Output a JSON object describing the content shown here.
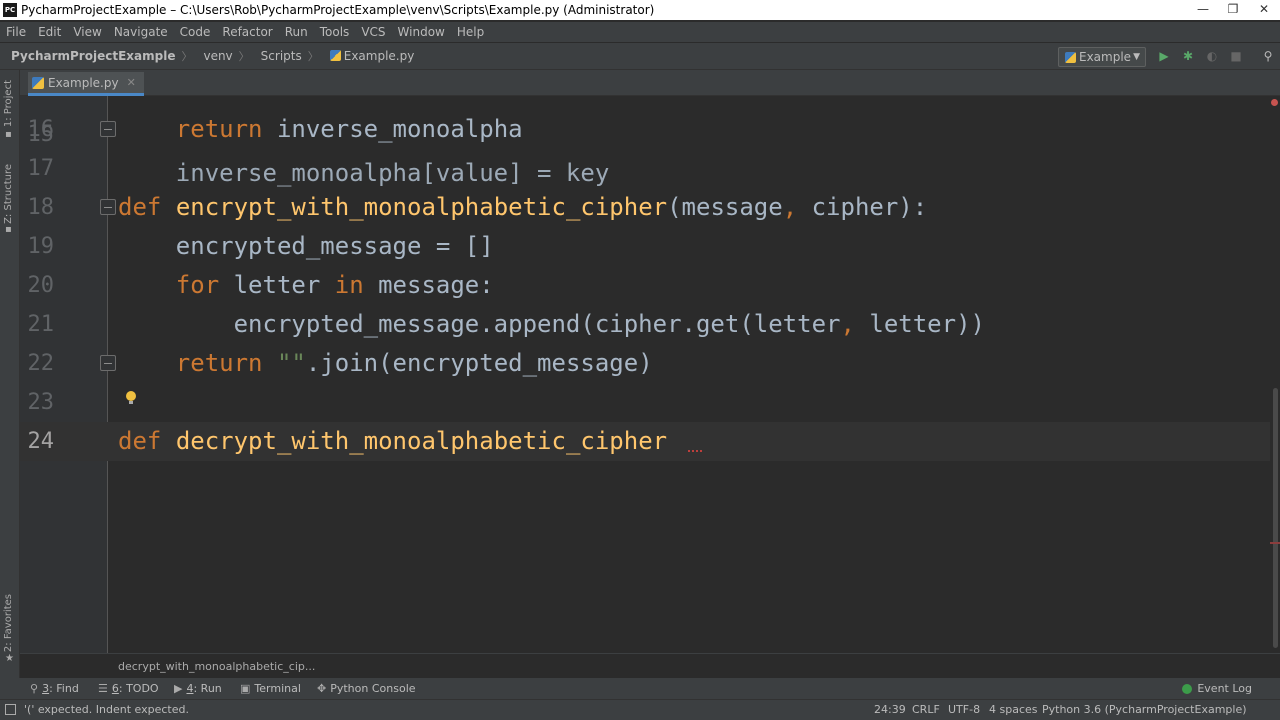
{
  "window": {
    "app_icon": "PC",
    "title": "PycharmProjectExample – C:\\Users\\Rob\\PycharmProjectExample\\venv\\Scripts\\Example.py (Administrator)",
    "controls": {
      "minimize": "—",
      "maximize": "❐",
      "close": "✕"
    }
  },
  "menu": [
    "File",
    "Edit",
    "View",
    "Navigate",
    "Code",
    "Refactor",
    "Run",
    "Tools",
    "VCS",
    "Window",
    "Help"
  ],
  "navbar": {
    "breadcrumbs": [
      "PycharmProjectExample",
      "venv",
      "Scripts",
      "Example.py"
    ],
    "run_config": "Example"
  },
  "left_strip": {
    "project": "1: Project",
    "structure": "Z: Structure",
    "favorites": "2: Favorites"
  },
  "tabs": [
    {
      "label": "Example.py",
      "active": true
    }
  ],
  "editor": {
    "partial_top_line": "    inverse_monoalpha[value] = key",
    "lines": [
      {
        "num": "16",
        "indent": "    ",
        "tokens": [
          {
            "t": "return",
            "c": "kw"
          },
          {
            "t": " inverse_monoalpha",
            "c": ""
          }
        ]
      },
      {
        "num": "17",
        "indent": "",
        "tokens": []
      },
      {
        "num": "18",
        "indent": "",
        "tokens": [
          {
            "t": "def",
            "c": "kw"
          },
          {
            "t": " ",
            "c": ""
          },
          {
            "t": "encrypt_with_monoalphabetic_cipher",
            "c": "fn"
          },
          {
            "t": "(message",
            "c": ""
          },
          {
            "t": ",",
            "c": "kw"
          },
          {
            "t": " cipher):",
            "c": ""
          }
        ]
      },
      {
        "num": "19",
        "indent": "    ",
        "tokens": [
          {
            "t": "encrypted_message = []",
            "c": ""
          }
        ]
      },
      {
        "num": "20",
        "indent": "    ",
        "tokens": [
          {
            "t": "for",
            "c": "kw"
          },
          {
            "t": " letter ",
            "c": ""
          },
          {
            "t": "in",
            "c": "kw"
          },
          {
            "t": " message:",
            "c": ""
          }
        ]
      },
      {
        "num": "21",
        "indent": "        ",
        "tokens": [
          {
            "t": "encrypted_message.append(cipher.get(letter",
            "c": ""
          },
          {
            "t": ",",
            "c": "kw"
          },
          {
            "t": " letter))",
            "c": ""
          }
        ]
      },
      {
        "num": "22",
        "indent": "    ",
        "tokens": [
          {
            "t": "return",
            "c": "kw"
          },
          {
            "t": " ",
            "c": ""
          },
          {
            "t": "\"\"",
            "c": "str"
          },
          {
            "t": ".join(encrypted_message)",
            "c": ""
          }
        ]
      },
      {
        "num": "23",
        "indent": "",
        "tokens": []
      },
      {
        "num": "24",
        "indent": "",
        "tokens": [
          {
            "t": "def",
            "c": "kw"
          },
          {
            "t": " ",
            "c": ""
          },
          {
            "t": "decrypt_with_monoalphabetic_cipher",
            "c": "fn"
          }
        ]
      }
    ],
    "current_line": "24"
  },
  "breadcrumb_bar": "decrypt_with_monoalphabetic_cip...",
  "tool_windows": [
    {
      "key": "3",
      "label": ": Find",
      "icon": "search-icon"
    },
    {
      "key": "6",
      "label": ": TODO",
      "icon": "list-icon"
    },
    {
      "key": "4",
      "label": ": Run",
      "icon": "play-icon"
    },
    {
      "key": "",
      "label": "Terminal",
      "icon": "terminal-icon"
    },
    {
      "key": "",
      "label": "Python Console",
      "icon": "python-icon"
    }
  ],
  "event_log": "Event Log",
  "status": {
    "message": "'(' expected. Indent expected.",
    "position": "24:39",
    "line_sep": "CRLF",
    "encoding": "UTF-8",
    "indent": "4 spaces",
    "interpreter": "Python 3.6 (PycharmProjectExample)"
  }
}
